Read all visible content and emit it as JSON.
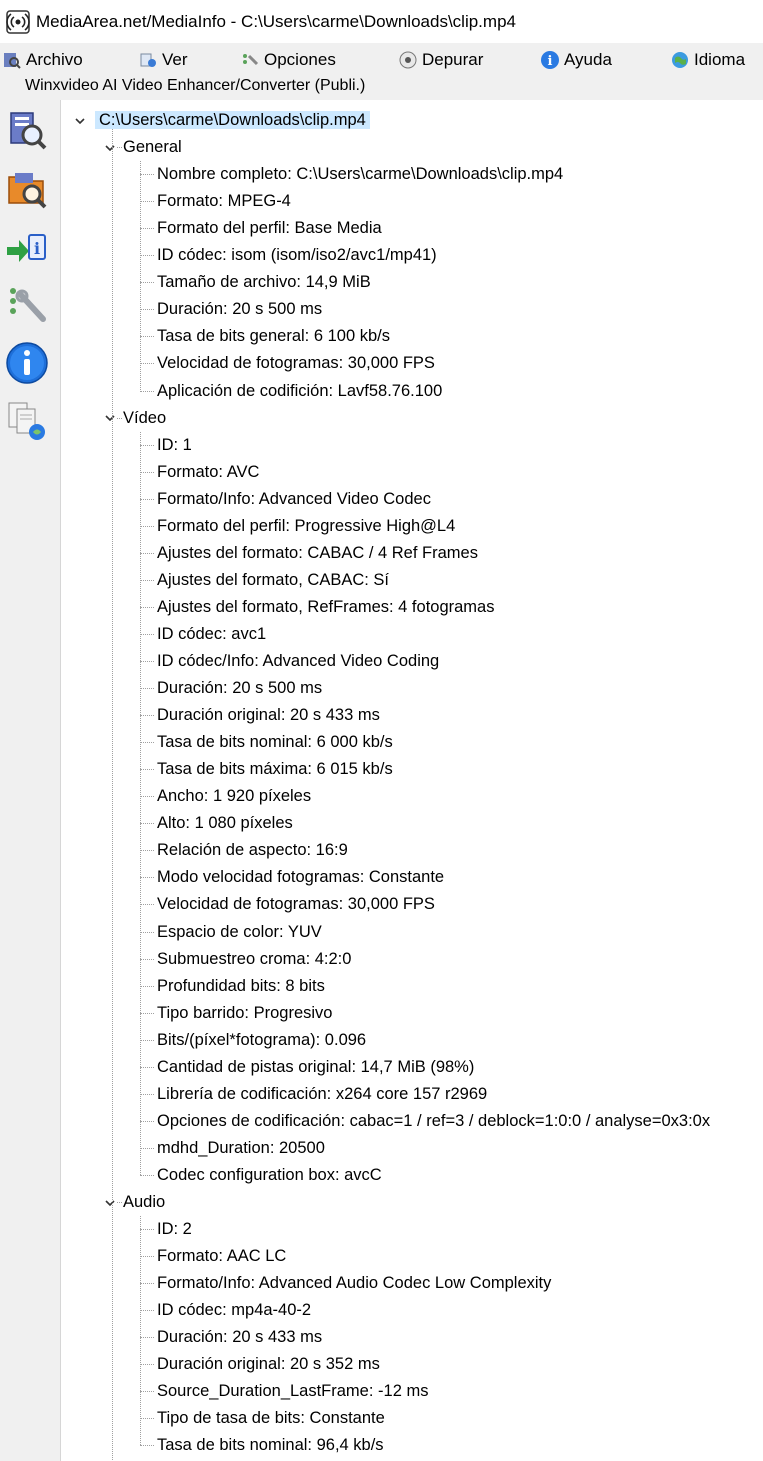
{
  "window": {
    "title": "MediaArea.net/MediaInfo - C:\\Users\\carme\\Downloads\\clip.mp4"
  },
  "menu": {
    "items": [
      {
        "label": "Archivo",
        "icon": "archive-icon"
      },
      {
        "label": "Ver",
        "icon": "view-icon"
      },
      {
        "label": "Opciones",
        "icon": "options-icon"
      },
      {
        "label": "Depurar",
        "icon": "debug-icon"
      },
      {
        "label": "Ayuda",
        "icon": "help-icon"
      },
      {
        "label": "Idioma",
        "icon": "language-icon"
      }
    ],
    "ad": "Winxvideo AI Video Enhancer/Converter (Publi.)"
  },
  "toolbar": {
    "buttons": [
      {
        "name": "open-file-button",
        "icon": "open-file-icon"
      },
      {
        "name": "open-folder-button",
        "icon": "open-folder-icon"
      },
      {
        "name": "export-button",
        "icon": "export-info-icon"
      },
      {
        "name": "preferences-button",
        "icon": "preferences-icon"
      },
      {
        "name": "about-button",
        "icon": "info-icon"
      },
      {
        "name": "knowledge-button",
        "icon": "documents-icon"
      }
    ]
  },
  "tree": {
    "root": "C:\\Users\\carme\\Downloads\\clip.mp4",
    "sections": [
      {
        "label": "General",
        "items": [
          "Nombre completo: C:\\Users\\carme\\Downloads\\clip.mp4",
          "Formato: MPEG-4",
          "Formato del perfil: Base Media",
          "ID códec: isom (isom/iso2/avc1/mp41)",
          "Tamaño de archivo: 14,9 MiB",
          "Duración: 20 s 500 ms",
          "Tasa de bits general: 6 100 kb/s",
          "Velocidad de fotogramas: 30,000 FPS",
          "Aplicación de codifición: Lavf58.76.100"
        ]
      },
      {
        "label": "Vídeo",
        "items": [
          "ID: 1",
          "Formato: AVC",
          "Formato/Info: Advanced Video Codec",
          "Formato del perfil: Progressive High@L4",
          "Ajustes del formato: CABAC / 4 Ref Frames",
          "Ajustes del formato, CABAC: Sí",
          "Ajustes del formato, RefFrames: 4 fotogramas",
          "ID códec: avc1",
          "ID códec/Info: Advanced Video Coding",
          "Duración: 20 s 500 ms",
          "Duración original: 20 s 433 ms",
          "Tasa de bits nominal: 6 000 kb/s",
          "Tasa de bits máxima: 6 015 kb/s",
          "Ancho: 1 920 píxeles",
          "Alto: 1 080 píxeles",
          "Relación de aspecto: 16:9",
          "Modo velocidad fotogramas: Constante",
          "Velocidad de fotogramas: 30,000 FPS",
          "Espacio de color: YUV",
          "Submuestreo croma: 4:2:0",
          "Profundidad bits: 8 bits",
          "Tipo barrido: Progresivo",
          "Bits/(píxel*fotograma): 0.096",
          "Cantidad de pistas original: 14,7 MiB (98%)",
          "Librería de codificación: x264 core 157 r2969",
          "Opciones de codificación: cabac=1 / ref=3 / deblock=1:0:0 / analyse=0x3:0x",
          "mdhd_Duration: 20500",
          "Codec configuration box: avcC"
        ]
      },
      {
        "label": "Audio",
        "items": [
          "ID: 2",
          "Formato: AAC LC",
          "Formato/Info: Advanced Audio Codec Low Complexity",
          "ID códec: mp4a-40-2",
          "Duración: 20 s 433 ms",
          "Duración original: 20 s 352 ms",
          "Source_Duration_LastFrame: -12 ms",
          "Tipo de tasa de bits: Constante",
          "Tasa de bits nominal: 96,4 kb/s"
        ]
      }
    ]
  },
  "colors": {
    "selection": "#cce8ff",
    "tree_bg": "#ffffff",
    "chrome_bg": "#f0f0f0"
  }
}
